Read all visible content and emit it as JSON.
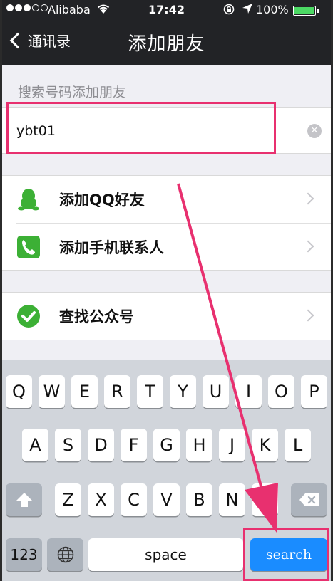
{
  "status_bar": {
    "carrier": "Alibaba",
    "time": "17:42",
    "battery_text": "100%",
    "signal_dots_filled": 3,
    "signal_dots_total": 5,
    "battery_level": 1.0
  },
  "nav": {
    "back_label": "通讯录",
    "title": "添加朋友"
  },
  "search": {
    "section_label": "搜索号码添加朋友",
    "value": "ybt01"
  },
  "options": [
    {
      "label": "添加QQ好友",
      "icon": "qq-penguin-icon"
    },
    {
      "label": "添加手机联系人",
      "icon": "phone-icon"
    }
  ],
  "options2": [
    {
      "label": "查找公众号",
      "icon": "check-circle-icon"
    }
  ],
  "keyboard": {
    "row1": [
      "Q",
      "W",
      "E",
      "R",
      "T",
      "Y",
      "U",
      "I",
      "O",
      "P"
    ],
    "row2": [
      "A",
      "S",
      "D",
      "F",
      "G",
      "H",
      "J",
      "K",
      "L"
    ],
    "row3": [
      "Z",
      "X",
      "C",
      "V",
      "B",
      "N",
      "M"
    ],
    "numbers_label": "123",
    "space_label": "space",
    "search_label": "search"
  },
  "colors": {
    "accent_green": "#3cb035",
    "highlight": "#e8306f",
    "search_key": "#1a8cff"
  }
}
